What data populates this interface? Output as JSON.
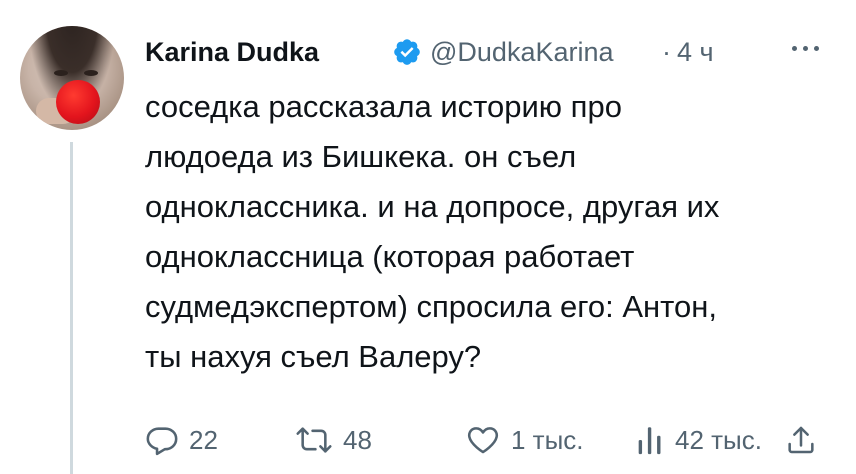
{
  "tweet": {
    "author": {
      "name": "Karina Dudka",
      "handle": "@DudkaKarina",
      "verified": true
    },
    "time": "4 ч",
    "dot": "·",
    "text_lines": [
      "соседка рассказала историю про",
      "людоеда из Бишкека. он съел",
      "одноклассника. и на допросе, другая их",
      "одноклассница (которая работает",
      "судмедэкспертом) спросила его: Антон,",
      "ты нахуя съел Валеру?"
    ],
    "stats": {
      "replies": "22",
      "retweets": "48",
      "likes": "1 тыс.",
      "views": "42 тыс."
    }
  },
  "colors": {
    "text": "#0f1419",
    "secondary": "#536471",
    "verified": "#1d9bf0",
    "thread_line": "#cfd9de"
  },
  "icons": {
    "verified": "verified-badge-icon",
    "more": "more-horizontal-icon",
    "reply": "reply-bubble-icon",
    "retweet": "retweet-icon",
    "like": "heart-icon",
    "views": "views-bar-chart-icon",
    "share": "share-icon"
  }
}
